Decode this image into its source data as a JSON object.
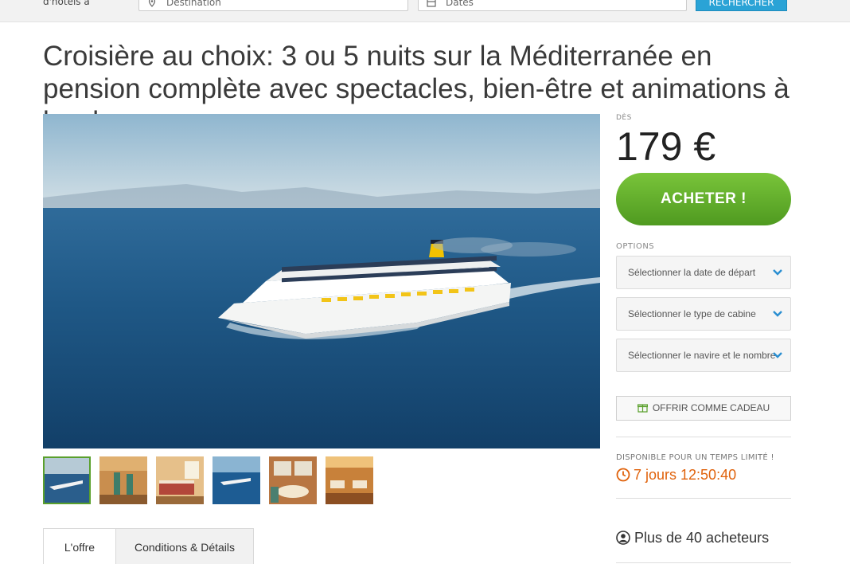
{
  "topbar": {
    "hotel_label": "d'hôtels à",
    "destination_placeholder": "Destination",
    "dates_placeholder": "Dates",
    "search_label": "RECHERCHER"
  },
  "deal": {
    "title": "Croisière au choix: 3 ou 5 nuits sur la Méditerranée en pension complète avec spectacles, bien-être et animations à bord",
    "price_prefix": "DÈS",
    "price": "179 €",
    "buy_label": "ACHETER !",
    "options_label": "OPTIONS",
    "options": [
      "Sélectionner la date de départ",
      "Sélectionner le type de cabine",
      "Sélectionner le navire et le nombre"
    ],
    "gift_label": "OFFRIR COMME CADEAU",
    "availability_label": "DISPONIBLE POUR UN TEMPS LIMITÉ !",
    "time_left": "7 jours 12:50:40",
    "buyers": "Plus de 40 acheteurs"
  },
  "gallery": {
    "thumbnails": [
      "ship-aerial",
      "lobby-sculpture",
      "cabin-room",
      "ship-sea",
      "restaurant-table",
      "dining-hall"
    ],
    "selected_index": 0
  },
  "tabs": [
    {
      "label": "L'offre",
      "active": true
    },
    {
      "label": "Conditions & Détails",
      "active": false
    }
  ],
  "colors": {
    "buy_button": "#5aa82a",
    "timer": "#e0620b",
    "active_thumb_border": "#5aa02c",
    "search_button": "#2aa3d6"
  }
}
